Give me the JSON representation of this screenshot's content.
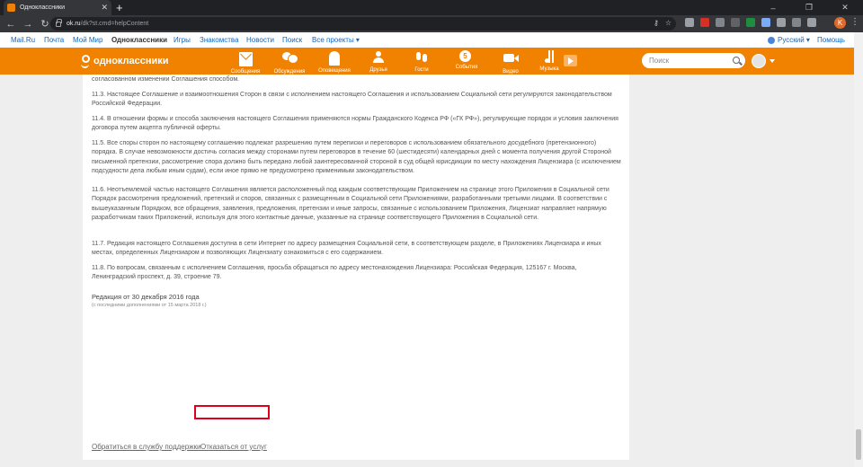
{
  "browser": {
    "tab_title": "Одноклассники",
    "tab_close": "✕",
    "new_tab": "+",
    "url_host": "ok.ru",
    "url_path": "/dk?st.cmd=helpContent",
    "profile_initial": "K",
    "window_controls": [
      "–",
      "❐",
      "✕"
    ]
  },
  "portal": {
    "links": [
      "Mail.Ru",
      "Почта",
      "Мой Мир",
      "Одноклассники",
      "Игры",
      "Знакомства",
      "Новости",
      "Поиск",
      "Все проекты ▾"
    ],
    "language": "Русский ▾",
    "help": "Помощь"
  },
  "header": {
    "logo": "одноклассники",
    "nav": [
      {
        "label": "Сообщения",
        "icon": "envelope-icon"
      },
      {
        "label": "Обсуждения",
        "icon": "discussions-icon"
      },
      {
        "label": "Оповещения",
        "icon": "bell-icon"
      },
      {
        "label": "Друзья",
        "icon": "friends-icon"
      },
      {
        "label": "Гости",
        "icon": "footprints-icon"
      },
      {
        "label": "События",
        "icon": "events-icon",
        "badge": "5"
      },
      {
        "label": "Видео",
        "icon": "video-icon"
      },
      {
        "label": "Музыка",
        "icon": "music-icon"
      }
    ],
    "search_placeholder": "Поиск"
  },
  "content": {
    "paragraphs": [
      "согласованном изменении Соглашения способом.",
      "11.3. Настоящее Соглашение и взаимоотношения Сторон в связи с исполнением настоящего Соглашения и использованием Социальной сети регулируются законодательством Российской Федерации.",
      "11.4. В отношении формы и способа заключения настоящего Соглашения применяются нормы Гражданского Кодекса РФ («ГК РФ»), регулирующие порядок и условия заключения договора путем акцепта публичной оферты.",
      "11.5. Все споры сторон по настоящему соглашению подлежат разрешению путем переписки и переговоров с использованием обязательного досудебного (претензионного) порядка. В случае невозможности достичь согласия между сторонами путем переговоров в течение 60 (шестидесяти) календарных дней с момента получения другой Стороной письменной претензии, рассмотрение спора должно быть передано любой заинтересованной стороной в суд общей юрисдикции по месту нахождения Лицензиара (с исключением подсудности дела любым иным судам), если иное прямо не предусмотрено применимым законодательством.",
      "11.6. Неотъемлемой частью настоящего Соглашения является расположенный под каждым соответствующим Приложением на странице этого Приложения в Социальной сети Порядок рассмотрения предложений, претензий и споров, связанных с размещенным в Социальной сети Приложениями, разработанными третьими лицами. В соответствии с вышеуказанным Порядком, все обращения, заявления, предложения, претензии и иные запросы, связанные с использованием Приложения, Лицензиат направляет напрямую разработчикам таких Приложений, используя для этого контактные данные, указанные на странице соответствующего Приложения в Социальной сети.",
      "11.7. Редакция настоящего Соглашения доступна в сети Интернет по адресу размещения Социальной сети, в соответствующем разделе, в Приложениях Лицензиара и иных местах, определенных Лицензиаром и позволяющих Лицензиату ознакомиться с его содержанием.",
      "11.8. По вопросам, связанным с исполнением Соглашения, просьба обращаться по адресу местонахождения Лицензиара: Российская Федерация, 125167 г. Москва, Ленинградский проспект, д. 39, строение 79."
    ],
    "edition": "Редакция от 30 декабря 2016 года",
    "edition_note": "(с последними дополнениями от 15 марта 2018 г.)"
  },
  "footer": {
    "support_link": "Обратиться в службу поддержки",
    "unsubscribe_link": "Отказаться от услуг"
  },
  "colors": {
    "ok_orange": "#f08200",
    "highlight_red": "#e0001b"
  }
}
